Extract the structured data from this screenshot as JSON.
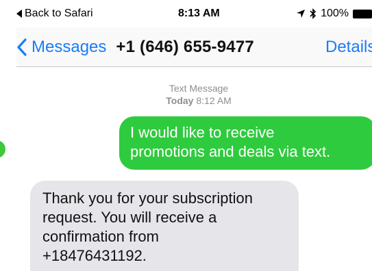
{
  "status_bar": {
    "back_label": "Back to Safari",
    "time": "8:13 AM",
    "battery": "100%"
  },
  "nav": {
    "back_label": "Messages",
    "contact": "+1 (646) 655-9477",
    "details_label": "Details"
  },
  "thread": {
    "service_label": "Text Message",
    "day_label": "Today",
    "time": "8:12 AM"
  },
  "messages": [
    {
      "direction": "sent",
      "lines": [
        "I would like to receive",
        "promotions and deals via text."
      ]
    },
    {
      "direction": "received",
      "lines": [
        "Thank you for your subscription",
        "request. You will receive a",
        "confirmation from",
        "+18476431192."
      ]
    }
  ],
  "colors": {
    "accent": "#1a7cf6",
    "sent_bubble": "#2fcb3e",
    "received_bubble": "#e5e5ea"
  },
  "icons": [
    "back-triangle-icon",
    "location-arrow-icon",
    "bluetooth-icon",
    "battery-icon",
    "chevron-left-icon"
  ]
}
